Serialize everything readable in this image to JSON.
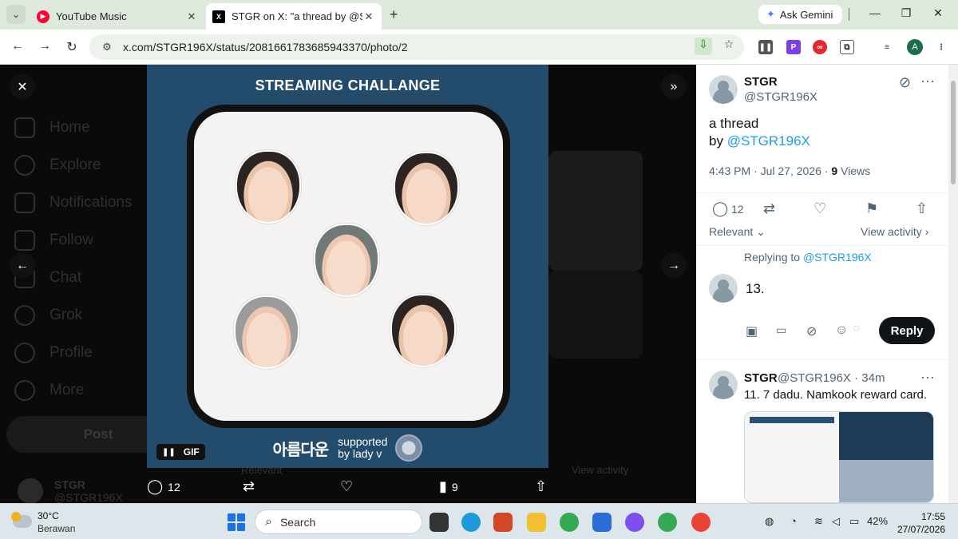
{
  "browser": {
    "tabs": [
      {
        "title": "YouTube Music"
      },
      {
        "title": "STGR on X: \"a thread by @STGR"
      }
    ],
    "ask_gemini": "Ask Gemini",
    "url": "x.com/STGR196X/status/2081661783685943370/photo/2",
    "profile_initial": "A",
    "icons": [
      "back-icon",
      "forward-icon",
      "reload-icon",
      "install-icon",
      "bookmark-star-icon",
      "extensions-icon"
    ]
  },
  "sidebar": {
    "items": [
      {
        "label": "Home"
      },
      {
        "label": "Explore"
      },
      {
        "label": "Notifications"
      },
      {
        "label": "Follow"
      },
      {
        "label": "Chat"
      },
      {
        "label": "Grok"
      },
      {
        "label": "Profile"
      },
      {
        "label": "More"
      }
    ],
    "post_label": "Post",
    "user_name": "STGR",
    "user_handle": "@STGR196X"
  },
  "media": {
    "title": "STREAMING CHALLANGE",
    "logo_text": "아름다운",
    "supported_line1": "supported",
    "supported_line2": "by lady v",
    "gif_label": "GIF",
    "bottom_actions": {
      "replies": "12",
      "views": "9"
    }
  },
  "background_dim": {
    "relevant": "Relevant",
    "view_activity": "View activity"
  },
  "tweet": {
    "name": "STGR",
    "handle": "@STGR196X",
    "text_line1": "a thread",
    "text_by": "by ",
    "text_mention": "@STGR196X",
    "time": "4:43 PM · Jul 27, 2026 · ",
    "views_count": "9",
    "views_label": " Views",
    "replies": "12",
    "sort_label": "Relevant",
    "view_activity": "View activity",
    "replying_to": "Replying to ",
    "replying_handle": "@STGR196X",
    "draft_text": "13.",
    "reply_button": "Reply"
  },
  "reply": {
    "name": "STGR",
    "handle": "@STGR196X · 34m",
    "text": "11. 7 dadu. Namkook reward card."
  },
  "taskbar": {
    "temperature": "30°C",
    "condition": "Berawan",
    "search_placeholder": "Search",
    "battery": "42%",
    "time": "17:55",
    "date": "27/07/2026"
  },
  "colors": {
    "media_bg": "#234b6b",
    "link": "#1d9bf0",
    "reply_button": "#0f1419"
  }
}
